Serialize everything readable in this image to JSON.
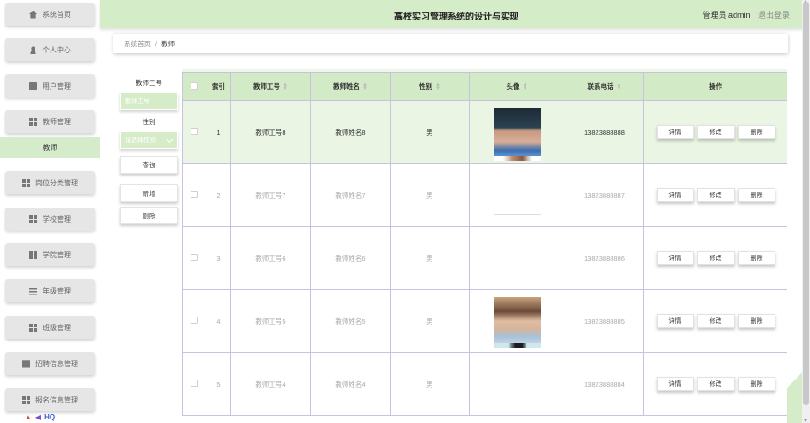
{
  "app": {
    "title": "高校实习管理系统的设计与实现",
    "user": "管理员 admin",
    "logout": "退出登录"
  },
  "sidebar": {
    "items": [
      {
        "label": "系统首页",
        "icon": "home-icon"
      },
      {
        "label": "个人中心",
        "icon": "user-icon"
      },
      {
        "label": "用户管理",
        "icon": "id-card-icon"
      },
      {
        "label": "教师管理",
        "icon": "grid-icon"
      },
      {
        "label": "岗位分类管理",
        "icon": "grid-icon"
      },
      {
        "label": "学校管理",
        "icon": "grid-icon"
      },
      {
        "label": "学院管理",
        "icon": "grid-icon"
      },
      {
        "label": "年级管理",
        "icon": "list-icon"
      },
      {
        "label": "班级管理",
        "icon": "grid-icon"
      },
      {
        "label": "招聘信息管理",
        "icon": "document-icon"
      },
      {
        "label": "报名信息管理",
        "icon": "grid-icon"
      }
    ],
    "active_sub": "教师",
    "logo_text": "HQ"
  },
  "breadcrumb": {
    "home": "系统首页",
    "separator": "/",
    "current": "教师"
  },
  "search": {
    "id_label": "教师工号",
    "id_placeholder": "教师工号",
    "gender_label": "性别",
    "gender_placeholder": "请选择性别",
    "query": "查询",
    "add": "新增",
    "delete": "删除"
  },
  "table": {
    "columns": [
      "索引",
      "教师工号",
      "教师姓名",
      "性别",
      "头像",
      "联系电话",
      "操作"
    ],
    "sortable": [
      false,
      true,
      true,
      true,
      true,
      true,
      false
    ],
    "rows": [
      {
        "index": "1",
        "id": "教师工号8",
        "name": "教师姓名8",
        "gender": "男",
        "phone": "13823888888",
        "avatar": "full-1"
      },
      {
        "index": "2",
        "id": "教师工号7",
        "name": "教师姓名7",
        "gender": "男",
        "phone": "13823888887",
        "avatar": "slim-a"
      },
      {
        "index": "3",
        "id": "教师工号6",
        "name": "教师姓名6",
        "gender": "男",
        "phone": "13823888886",
        "avatar": "slim-b"
      },
      {
        "index": "4",
        "id": "教师工号5",
        "name": "教师姓名5",
        "gender": "男",
        "phone": "13823888885",
        "avatar": "full-4"
      },
      {
        "index": "5",
        "id": "教师工号4",
        "name": "教师姓名4",
        "gender": "男",
        "phone": "13823888884",
        "avatar": "slim-c"
      }
    ],
    "actions": {
      "detail": "详情",
      "edit": "修改",
      "delete": "删除"
    }
  },
  "colors": {
    "accent": "#d5ecc8",
    "row_highlight": "#eaf5e3",
    "grid_border": "#c7c2df"
  }
}
